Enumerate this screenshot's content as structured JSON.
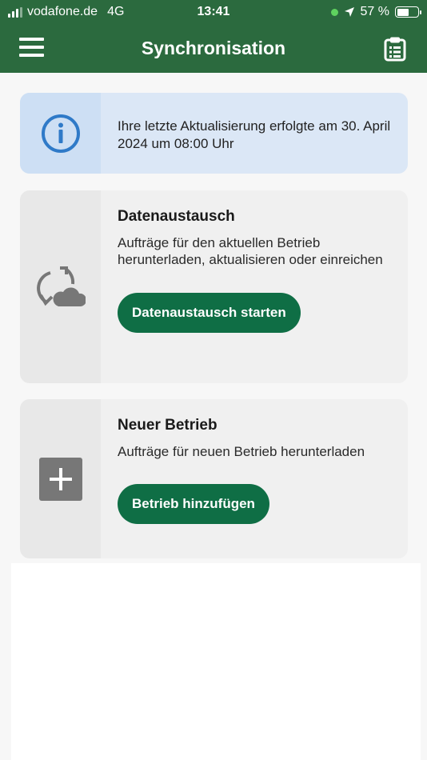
{
  "status_bar": {
    "carrier": "vodafone.de",
    "network": "4G",
    "time": "13:41",
    "battery": "57 %",
    "battery_level": 0.57
  },
  "app_bar": {
    "title": "Synchronisation",
    "menu_icon": "hamburger-menu-icon",
    "action_icon": "clipboard-list-icon"
  },
  "info_card": {
    "icon": "info-circle-icon",
    "text": "Ihre letzte Aktualisierung erfolgte am 30. April 2024 um 08:00 Uhr"
  },
  "sync_card": {
    "icon": "sync-cloud-icon",
    "title": "Datenaustausch",
    "description": "Aufträge für den aktuellen Betrieb herunterladen, aktualisieren oder einreichen",
    "button": "Datenaustausch starten"
  },
  "new_card": {
    "icon": "plus-square-icon",
    "title": "Neuer Betrieb",
    "description": "Aufträge für neuen Betrieb herunterladen",
    "button": "Betrieb hinzufügen"
  },
  "colors": {
    "header": "#2b6a3e",
    "button": "#0f6e45",
    "info_bg": "#dbe7f6",
    "info_icon": "#2f7ac8",
    "card_bg": "#f0f0f0"
  }
}
